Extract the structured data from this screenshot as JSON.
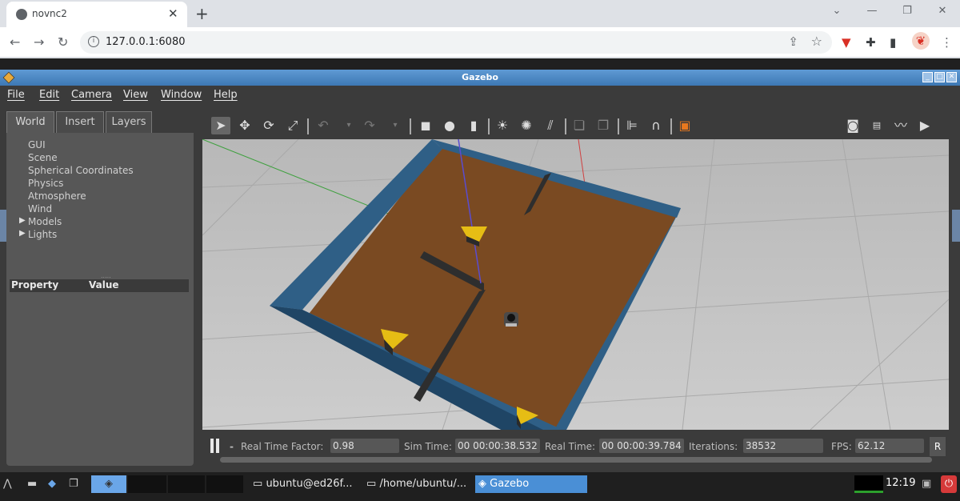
{
  "browser": {
    "tab_title": "novnc2",
    "url": "127.0.0.1:6080"
  },
  "gazebo": {
    "window_title": "Gazebo",
    "menu": [
      "File",
      "Edit",
      "Camera",
      "View",
      "Window",
      "Help"
    ],
    "left_tabs": [
      "World",
      "Insert",
      "Layers"
    ],
    "tree": [
      {
        "label": "GUI",
        "expandable": false
      },
      {
        "label": "Scene",
        "expandable": false
      },
      {
        "label": "Spherical Coordinates",
        "expandable": false
      },
      {
        "label": "Physics",
        "expandable": false
      },
      {
        "label": "Atmosphere",
        "expandable": false
      },
      {
        "label": "Wind",
        "expandable": false
      },
      {
        "label": "Models",
        "expandable": true
      },
      {
        "label": "Lights",
        "expandable": true
      }
    ],
    "property_header": {
      "property": "Property",
      "value": "Value"
    },
    "status": {
      "real_time_factor_label": "Real Time Factor:",
      "real_time_factor": "0.98",
      "sim_time_label": "Sim Time:",
      "sim_time": "00 00:00:38.532",
      "real_time_label": "Real Time:",
      "real_time": "00 00:00:39.784",
      "iterations_label": "Iterations:",
      "iterations": "38532",
      "fps_label": "FPS:",
      "fps": "62.12",
      "reset_label": "R",
      "step_label": "-"
    },
    "colors": {
      "wall": "#2f5f86",
      "floor": "#7a4a22",
      "cheese": "#e6bd14"
    }
  },
  "taskbar": {
    "items": [
      "ubuntu@ed26f...",
      "/home/ubuntu/...",
      "Gazebo"
    ],
    "clock": "12:19"
  }
}
